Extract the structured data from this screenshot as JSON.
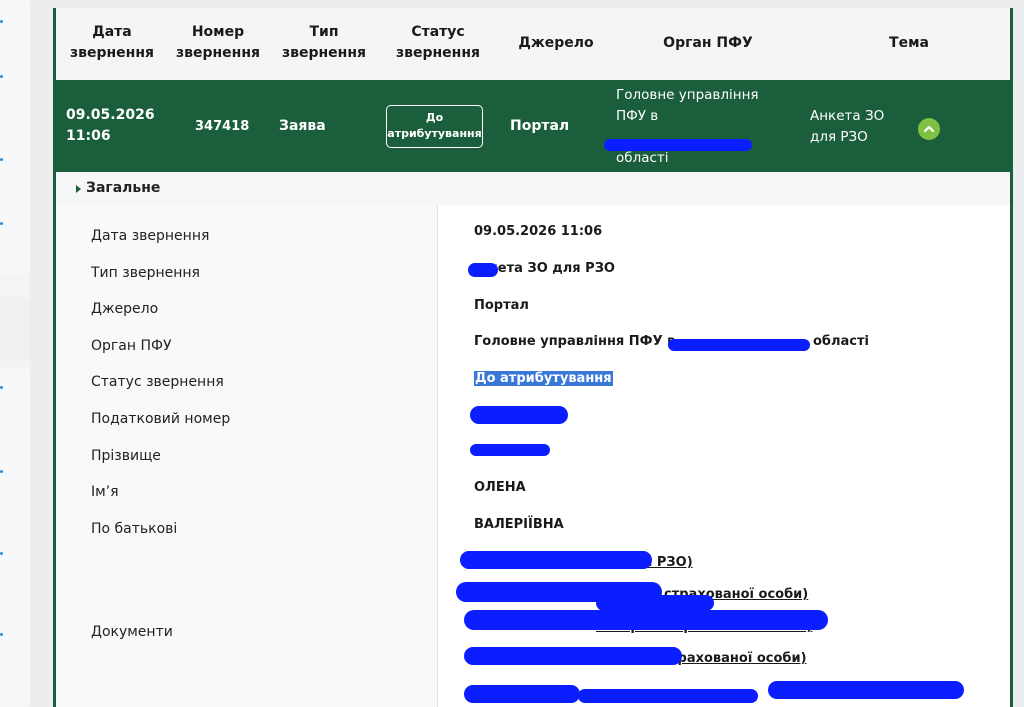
{
  "table": {
    "headers": {
      "date": [
        "Дата",
        "звернення"
      ],
      "number": [
        "Номер",
        "звернення"
      ],
      "type": [
        "Тип",
        "звернення"
      ],
      "status": [
        "Статус",
        "звернення"
      ],
      "source": "Джерело",
      "organ": "Орган ПФУ",
      "topic": "Тема"
    },
    "row": {
      "date": "09.05.2026",
      "time": "11:06",
      "number": "347418",
      "type": "Заява",
      "status": [
        "До",
        "атрибутування"
      ],
      "source": "Портал",
      "organ": [
        "Головне управління",
        "ПФУ в",
        "області"
      ],
      "topic": [
        "Анкета ЗО",
        "для РЗО"
      ]
    }
  },
  "section": {
    "title": "Загальне"
  },
  "fields": {
    "labels": {
      "date": "Дата звернення",
      "type": "Тип звернення",
      "source": "Джерело",
      "organ": "Орган ПФУ",
      "status": "Статус звернення",
      "tax": "Податковий номер",
      "surname": "Прізвище",
      "name": "Ім’я",
      "patronymic": "По батькові",
      "documents": "Документи"
    },
    "values": {
      "date": "09.05.2026 11:06",
      "type": "нкета ЗО для РЗО",
      "source": "Портал",
      "organ_start": "Головне управління ПФУ в",
      "organ_end": "області",
      "status": "До атрибутування",
      "name": "ОЛЕНА",
      "patronymic": "ВАЛЕРІЇВНА"
    },
    "documents": [
      "я РЗО)",
      "страхованої особи)",
      "аспорт застрахованої особи)",
      "трахованої особи)"
    ]
  },
  "colors": {
    "brand_green": "#1b5e3b",
    "accent_green": "#7fc241",
    "redaction": "#0a1eff"
  }
}
